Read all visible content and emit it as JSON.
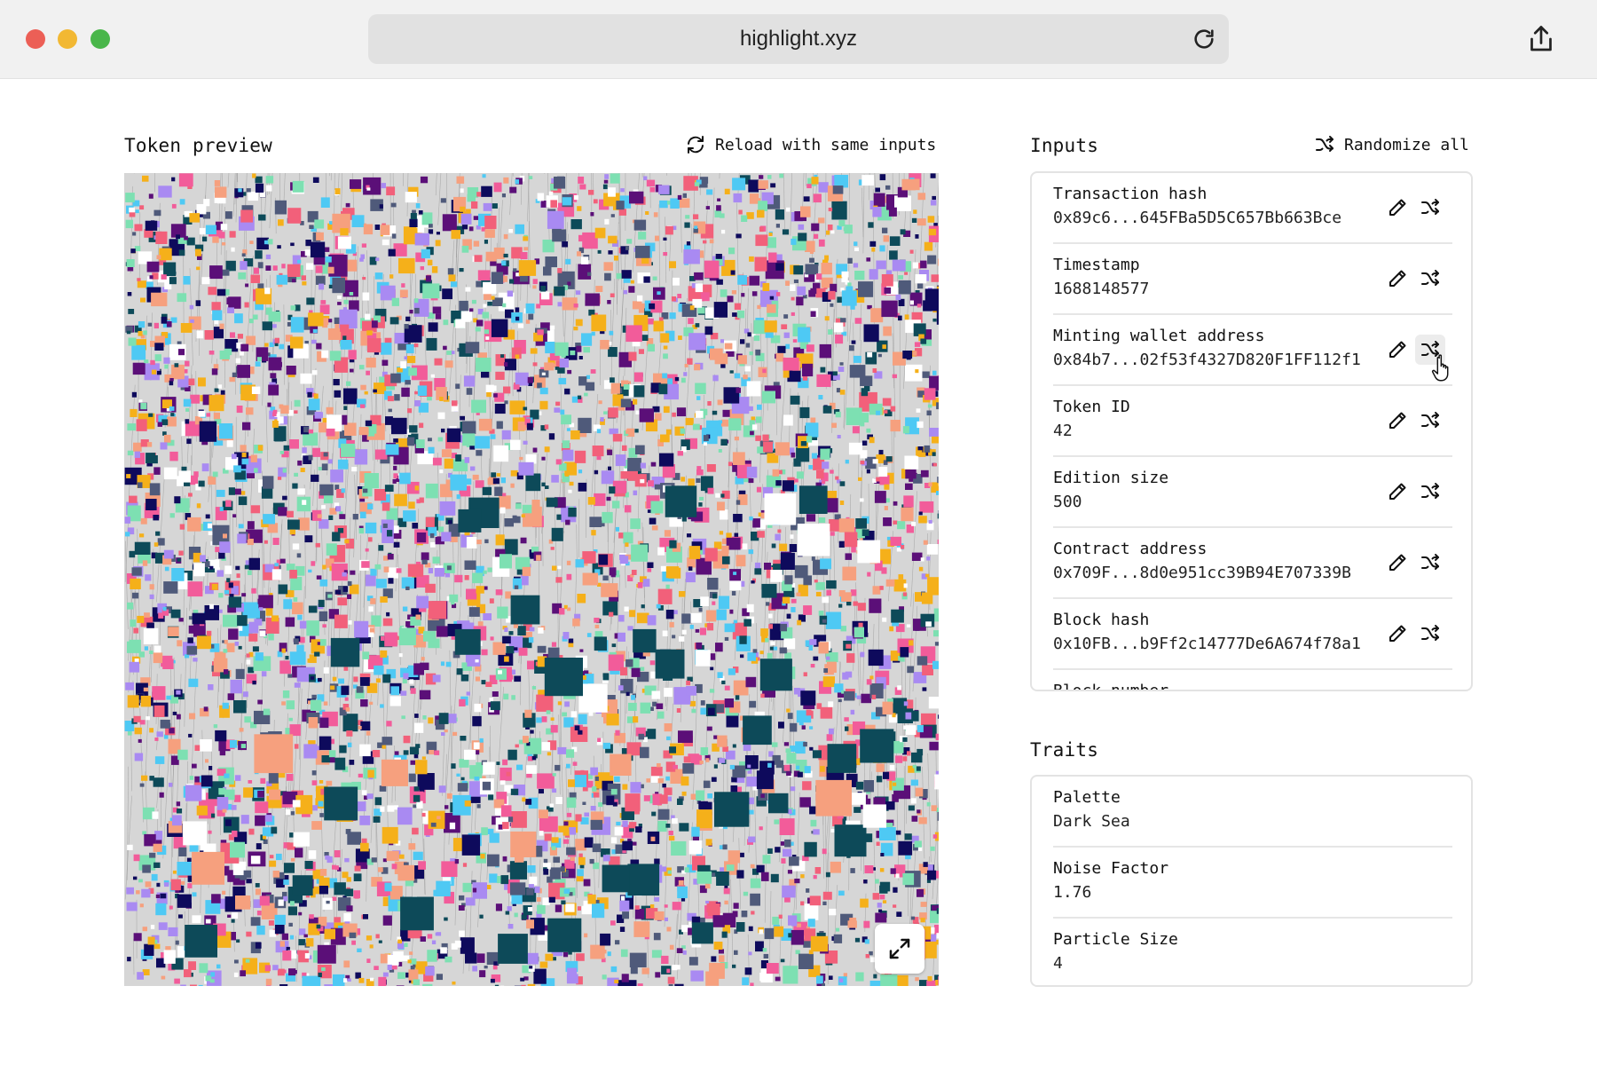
{
  "browser": {
    "url": "highlight.xyz",
    "icons": {
      "reload": "reload-icon",
      "share": "share-icon"
    }
  },
  "preview": {
    "title": "Token preview",
    "reload_label": "Reload with same inputs",
    "expand_icon": "expand-icon"
  },
  "inputs": {
    "title": "Inputs",
    "randomize_label": "Randomize all",
    "items": [
      {
        "label": "Transaction hash",
        "value": "0x89c6...645FBa5D5C657Bb663Bce"
      },
      {
        "label": "Timestamp",
        "value": "1688148577"
      },
      {
        "label": "Minting wallet address",
        "value": "0x84b7...02f53f4327D820F1FF112f1"
      },
      {
        "label": "Token ID",
        "value": "42"
      },
      {
        "label": "Edition size",
        "value": "500"
      },
      {
        "label": "Contract address",
        "value": "0x709F...8d0e951cc39B94E707339B"
      },
      {
        "label": "Block hash",
        "value": "0x10FB...b9Ff2c14777De6A674f78a1"
      },
      {
        "label": "Block number",
        "value": ""
      }
    ]
  },
  "traits": {
    "title": "Traits",
    "items": [
      {
        "label": "Palette",
        "value": "Dark Sea"
      },
      {
        "label": "Noise Factor",
        "value": "1.76"
      },
      {
        "label": "Particle Size",
        "value": "4"
      }
    ]
  },
  "art_palette": [
    "#f2607a",
    "#7de0b2",
    "#4ec9f4",
    "#0e0a5c",
    "#4f5a7a",
    "#a98af2",
    "#f6a07e",
    "#ffffff",
    "#5b0f78",
    "#f5b01a",
    "#0d4a59",
    "#f25c9a"
  ]
}
